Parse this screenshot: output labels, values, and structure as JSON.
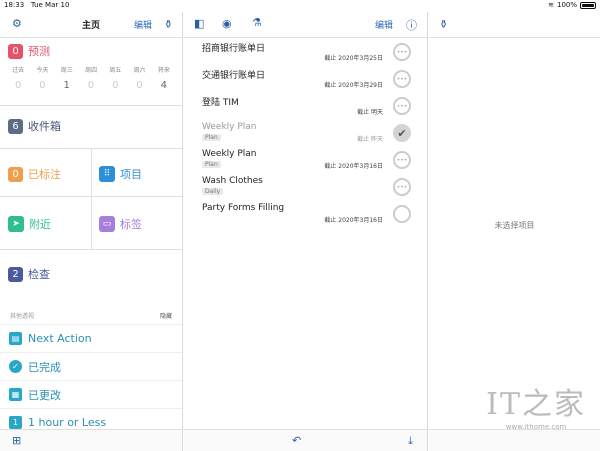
{
  "status_bar": {
    "time": "18:33",
    "date": "Tue Mar 10",
    "battery": "100%"
  },
  "sidebar": {
    "title": "主页",
    "edit_label": "编辑",
    "forecast": {
      "count": "0",
      "label": "预测",
      "days": [
        {
          "label": "过去",
          "count": "0"
        },
        {
          "label": "今天",
          "count": "0"
        },
        {
          "label": "周三",
          "count": "1"
        },
        {
          "label": "周四",
          "count": "0"
        },
        {
          "label": "周五",
          "count": "0"
        },
        {
          "label": "周六",
          "count": "0"
        },
        {
          "label": "将来",
          "count": "4"
        }
      ]
    },
    "inbox": {
      "count": "6",
      "label": "收件箱"
    },
    "flagged": {
      "count": "0",
      "label": "已标注"
    },
    "projects": {
      "label": "项目"
    },
    "nearby": {
      "label": "附近"
    },
    "tags": {
      "label": "标签"
    },
    "review": {
      "count": "2",
      "label": "检查"
    },
    "perspectives_header": "其他透视",
    "hide_label": "隐藏",
    "perspectives": [
      {
        "label": "Next Action"
      },
      {
        "label": "已完成"
      },
      {
        "label": "已更改"
      },
      {
        "label": "1 hour or Less"
      }
    ]
  },
  "task_list": {
    "edit_label": "编辑",
    "tasks": [
      {
        "name": "招商银行账单日",
        "tag": "",
        "due": "截止 2020年3月25日",
        "done": false
      },
      {
        "name": "交通银行账单日",
        "tag": "",
        "due": "截止 2020年3月29日",
        "done": false
      },
      {
        "name": "登陆 TIM",
        "tag": "",
        "due": "截止 明天",
        "done": false
      },
      {
        "name": "Weekly Plan",
        "tag": "Plan",
        "due": "截止 昨天",
        "done": true
      },
      {
        "name": "Weekly Plan",
        "tag": "Plan",
        "due": "截止 2020年3月16日",
        "done": false
      },
      {
        "name": "Wash Clothes",
        "tag": "Daily",
        "due": "",
        "done": false
      },
      {
        "name": "Party Forms Filling",
        "tag": "",
        "due": "截止 2020年3月16日",
        "done": false
      }
    ]
  },
  "detail": {
    "empty_text": "未选择项目"
  },
  "watermark": {
    "logo": "IT之家",
    "url": "www.ithome.com"
  }
}
